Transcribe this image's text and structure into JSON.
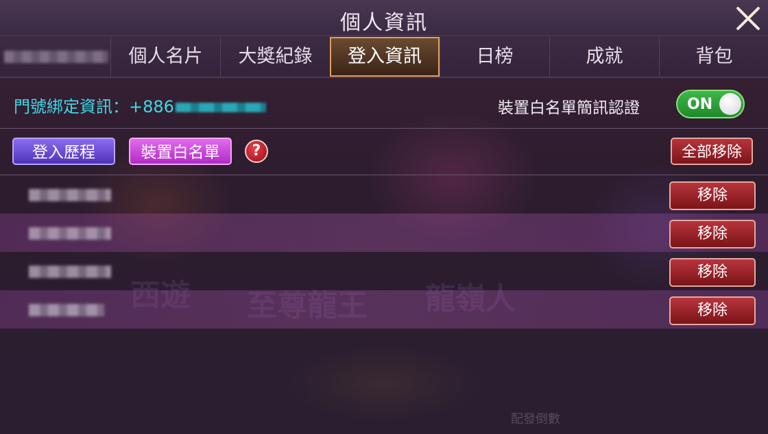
{
  "header": {
    "title": "個人資訊"
  },
  "tabs": [
    {
      "label": "個人名片"
    },
    {
      "label": "大獎紀錄"
    },
    {
      "label": "登入資訊",
      "active": true
    },
    {
      "label": "日榜"
    },
    {
      "label": "成就"
    },
    {
      "label": "背包"
    }
  ],
  "binding": {
    "label": "門號綁定資訊：+886"
  },
  "sms_verify": {
    "label": "裝置白名單簡訊認證",
    "toggle_label": "ON",
    "enabled": true
  },
  "actions": {
    "login_history": "登入歷程",
    "device_whitelist": "裝置白名單",
    "help": "?",
    "remove_all": "全部移除"
  },
  "devices": [
    {
      "remove_label": "移除"
    },
    {
      "remove_label": "移除"
    },
    {
      "remove_label": "移除"
    },
    {
      "remove_label": "移除"
    }
  ],
  "background_text": {
    "footer": "配發倒數"
  },
  "colors": {
    "accent_cyan": "#3fd8e6",
    "toggle_green": "#2aa83a",
    "history_purple": "#6a4ad8",
    "whitelist_magenta": "#cc44dd",
    "remove_red": "#9a2026",
    "tab_active_border": "#e0a05a"
  }
}
